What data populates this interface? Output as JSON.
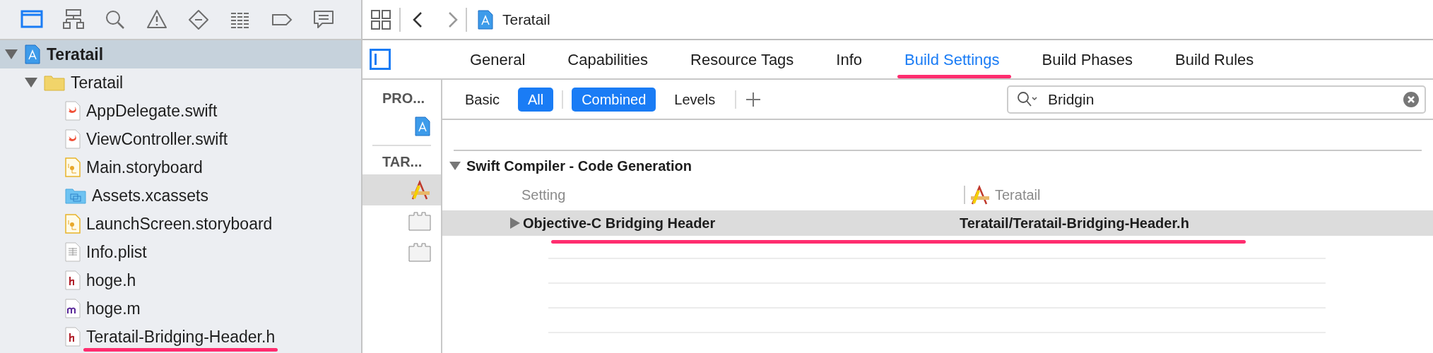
{
  "navigator_tabs": [
    {
      "kind": "folder",
      "selected": true
    },
    {
      "kind": "hierarchy",
      "selected": false
    },
    {
      "kind": "search",
      "selected": false
    },
    {
      "kind": "warning",
      "selected": false
    },
    {
      "kind": "diamond",
      "selected": false
    },
    {
      "kind": "list",
      "selected": false
    },
    {
      "kind": "tag",
      "selected": false
    },
    {
      "kind": "comment",
      "selected": false
    }
  ],
  "navigator": {
    "tree": [
      {
        "label": "Teratail",
        "kind": "project",
        "expanded": true,
        "selected": true,
        "annotated": false,
        "children": [
          {
            "label": "Teratail",
            "kind": "folder",
            "expanded": true,
            "selected": false,
            "annotated": false,
            "children": [
              {
                "label": "AppDelegate.swift",
                "kind": "swift",
                "selected": false,
                "annotated": false
              },
              {
                "label": "ViewController.swift",
                "kind": "swift",
                "selected": false,
                "annotated": false
              },
              {
                "label": "Main.storyboard",
                "kind": "storyboard",
                "selected": false,
                "annotated": false
              },
              {
                "label": "Assets.xcassets",
                "kind": "assets",
                "selected": false,
                "annotated": false
              },
              {
                "label": "LaunchScreen.storyboard",
                "kind": "storyboard",
                "selected": false,
                "annotated": false
              },
              {
                "label": "Info.plist",
                "kind": "plist",
                "selected": false,
                "annotated": false
              },
              {
                "label": "hoge.h",
                "kind": "h",
                "selected": false,
                "annotated": false
              },
              {
                "label": "hoge.m",
                "kind": "m",
                "selected": false,
                "annotated": false
              },
              {
                "label": "Teratail-Bridging-Header.h",
                "kind": "h",
                "selected": false,
                "annotated": true
              }
            ]
          }
        ]
      }
    ]
  },
  "jump_bar": {
    "title": "Teratail"
  },
  "editor_tabs": [
    {
      "label": "General",
      "selected": false,
      "annotated": false
    },
    {
      "label": "Capabilities",
      "selected": false,
      "annotated": false
    },
    {
      "label": "Resource Tags",
      "selected": false,
      "annotated": false
    },
    {
      "label": "Info",
      "selected": false,
      "annotated": false
    },
    {
      "label": "Build Settings",
      "selected": true,
      "annotated": true
    },
    {
      "label": "Build Phases",
      "selected": false,
      "annotated": false
    },
    {
      "label": "Build Rules",
      "selected": false,
      "annotated": false
    }
  ],
  "targets_list": {
    "project_header": "PRO...",
    "projects": [
      {
        "kind": "project",
        "selected": false
      }
    ],
    "target_header": "TAR...",
    "targets": [
      {
        "kind": "app",
        "selected": true
      },
      {
        "kind": "brick",
        "selected": false
      },
      {
        "kind": "brick",
        "selected": false
      }
    ]
  },
  "filter_bar": {
    "scope": [
      {
        "label": "Basic",
        "selected": false
      },
      {
        "label": "All",
        "selected": true
      }
    ],
    "view": [
      {
        "label": "Combined",
        "selected": true
      },
      {
        "label": "Levels",
        "selected": false
      }
    ],
    "search": {
      "value": "Bridgin"
    }
  },
  "section": {
    "title": "Swift Compiler - Code Generation",
    "expanded": true,
    "columns": [
      {
        "label": "Setting",
        "kind": "plain"
      },
      {
        "label": "Teratail",
        "kind": "target"
      }
    ],
    "rows": [
      {
        "setting": "Objective-C Bridging Header",
        "value": "Teratail/Teratail-Bridging-Header.h",
        "selected": true,
        "expanded": false,
        "annotated": true
      }
    ]
  }
}
